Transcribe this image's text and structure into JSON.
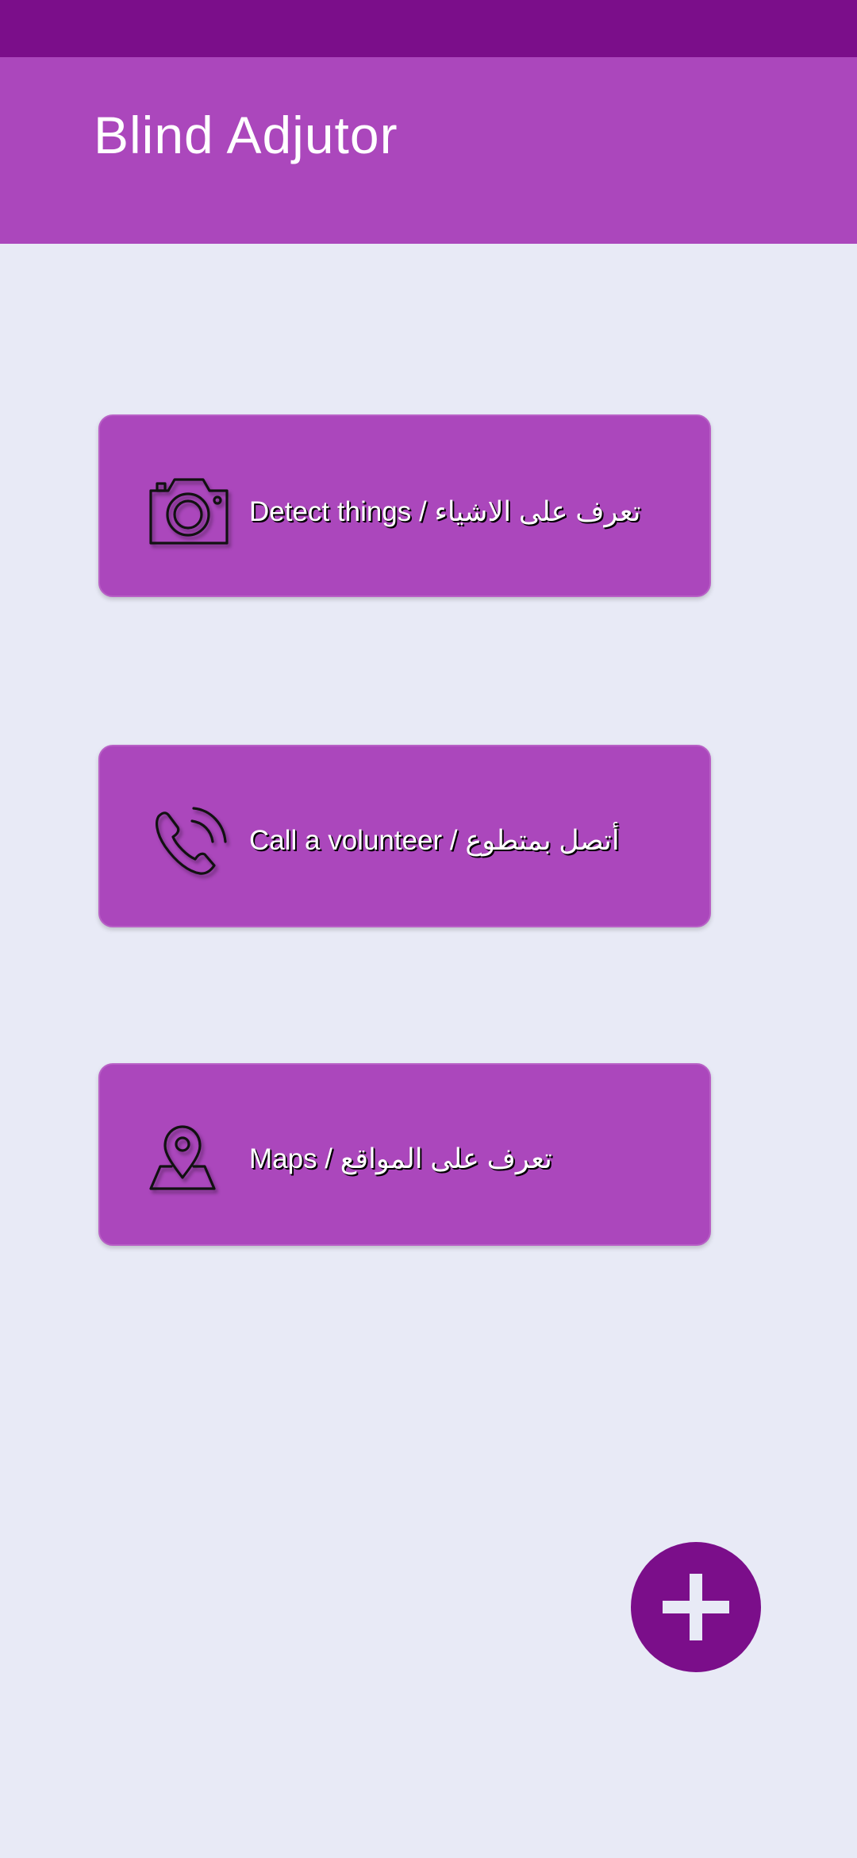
{
  "app": {
    "title": "Blind Adjutor"
  },
  "actions": [
    {
      "label": "Detect things / تعرف على الاشياء",
      "icon": "camera-icon"
    },
    {
      "label": "Call a volunteer / أتصل بمتطوع",
      "icon": "phone-call-icon"
    },
    {
      "label": "Maps / تعرف على المواقع",
      "icon": "map-pin-icon"
    }
  ],
  "fab": {
    "icon": "plus-icon"
  },
  "colors": {
    "status_bar": "#7b0e8a",
    "app_bar": "#ab47bc",
    "background": "#e8eaf6",
    "card": "#ab47bc",
    "fab": "#7b0e8a",
    "text": "#ffffff"
  }
}
